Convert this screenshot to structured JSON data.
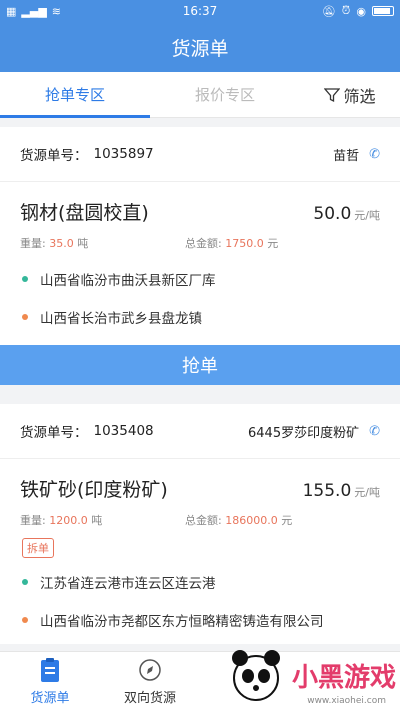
{
  "status_bar": {
    "time": "16:37"
  },
  "header": {
    "title": "货源单"
  },
  "tabs": [
    {
      "label": "抢单专区"
    },
    {
      "label": "报价专区"
    }
  ],
  "filter": {
    "label": "筛选"
  },
  "orders": [
    {
      "order_label": "货源单号：",
      "order_no": "1035897",
      "contact": "苗哲",
      "goods": "钢材(盘圆校直)",
      "price": "50.0",
      "unit": "元/吨",
      "weight_label": "重量: ",
      "weight": "35.0",
      "weight_unit": "吨",
      "amount_label": "总金额: ",
      "amount": "1750.0",
      "amount_unit": "元",
      "from": "山西省临汾市曲沃县新区厂库",
      "to": "山西省长治市武乡县盘龙镇"
    },
    {
      "order_label": "货源单号：",
      "order_no": "1035408",
      "contact": "6445罗莎印度粉矿",
      "goods": "铁矿砂(印度粉矿)",
      "price": "155.0",
      "unit": "元/吨",
      "weight_label": "重量: ",
      "weight": "1200.0",
      "weight_unit": "吨",
      "amount_label": "总金额: ",
      "amount": "186000.0",
      "amount_unit": "元",
      "tag": "拆单",
      "from": "江苏省连云港市连云区连云港",
      "to": "山西省临汾市尧都区东方恒略精密铸造有限公司"
    }
  ],
  "grab_button": "抢单",
  "bottom_nav": [
    {
      "label": "货源单",
      "icon": "clipboard-icon"
    },
    {
      "label": "双向货源",
      "icon": "compass-icon"
    }
  ],
  "watermark": {
    "text": "小黑游戏",
    "url": "www.xiaohei.com"
  },
  "colors": {
    "primary": "#4a90e2",
    "accent": "#2e7be6",
    "highlight": "#e8755c"
  }
}
